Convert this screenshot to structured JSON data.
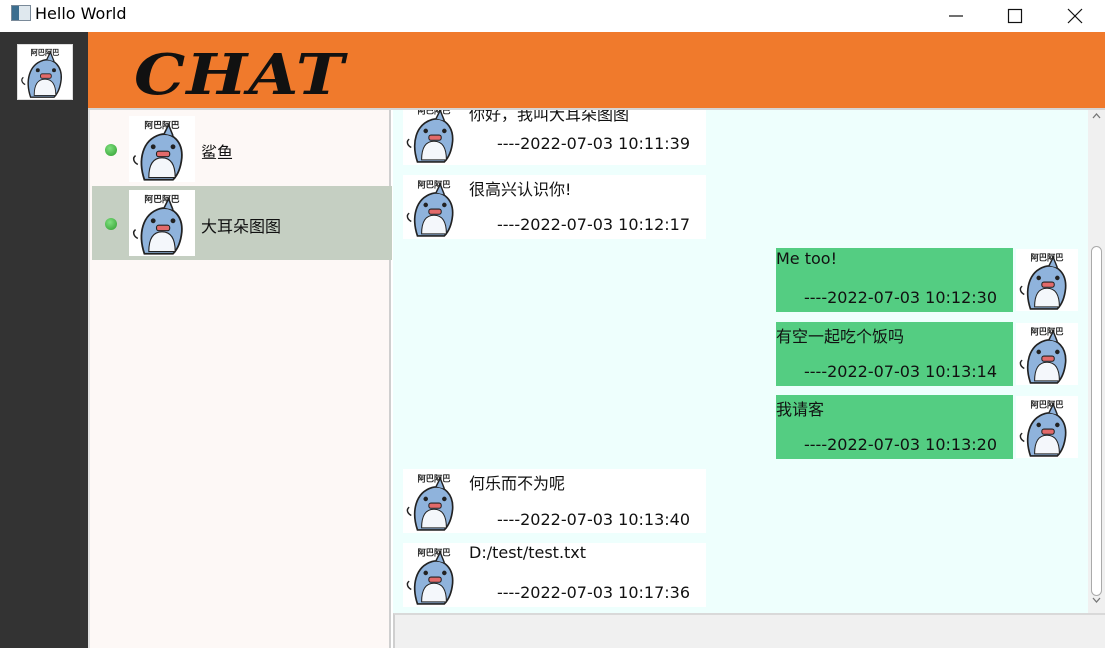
{
  "window": {
    "title": "Hello World"
  },
  "header": {
    "logo": "CHAT",
    "accent_color": "#f07a2c"
  },
  "contacts": [
    {
      "name": "鲨鱼",
      "online": true,
      "selected": false,
      "avatar_label": "阿巴阿巴"
    },
    {
      "name": "大耳朵图图",
      "online": true,
      "selected": true,
      "avatar_label": "阿巴阿巴"
    }
  ],
  "messages": [
    {
      "direction": "in",
      "text": "你好，我叫大耳朵图图",
      "time": "----2022-07-03 10:11:39"
    },
    {
      "direction": "in",
      "text": "很高兴认识你!",
      "time": "----2022-07-03 10:12:17"
    },
    {
      "direction": "out",
      "text": "Me too!",
      "time": "----2022-07-03 10:12:30"
    },
    {
      "direction": "out",
      "text": "有空一起吃个饭吗",
      "time": "----2022-07-03 10:13:14"
    },
    {
      "direction": "out",
      "text": "我请客",
      "time": "----2022-07-03 10:13:20"
    },
    {
      "direction": "in",
      "text": "何乐而不为呢",
      "time": "----2022-07-03 10:13:40"
    },
    {
      "direction": "in",
      "text": "D:/test/test.txt",
      "time": "----2022-07-03 10:17:36"
    }
  ],
  "avatar": {
    "label": "阿巴阿巴",
    "icon": "shark-sticker-icon"
  },
  "colors": {
    "outgoing_bubble": "#54cd82",
    "incoming_bubble": "#ffffff",
    "chat_bg": "#eefffd",
    "selected_contact": "#c5cfc2"
  }
}
